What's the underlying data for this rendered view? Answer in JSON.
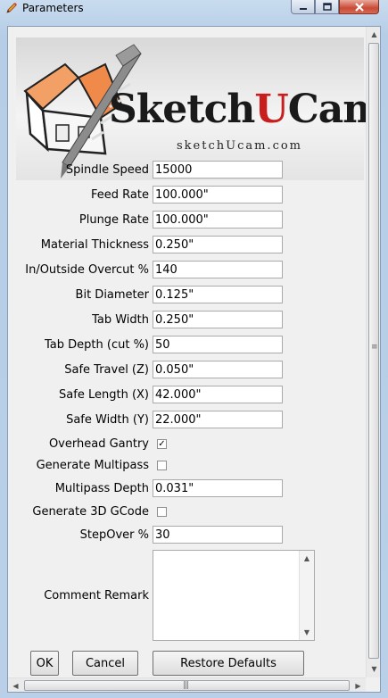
{
  "window": {
    "title": "Parameters",
    "controls": {
      "minimize_icon": "minimize-icon",
      "maximize_icon": "maximize-icon",
      "close_icon": "close-icon"
    }
  },
  "logo": {
    "wordmark_prefix": "Sketch",
    "wordmark_accent": "U",
    "wordmark_suffix": "Cam",
    "registered": "®",
    "url": "sketchUcam.com",
    "accent_color": "#c81e1e"
  },
  "fields": [
    {
      "label": "Spindle Speed",
      "value": "15000"
    },
    {
      "label": "Feed Rate",
      "value": "100.000\""
    },
    {
      "label": "Plunge Rate",
      "value": "100.000\""
    },
    {
      "label": "Material Thickness",
      "value": "0.250\""
    },
    {
      "label": "In/Outside Overcut %",
      "value": "140"
    },
    {
      "label": "Bit Diameter",
      "value": "0.125\""
    },
    {
      "label": "Tab Width",
      "value": "0.250\""
    },
    {
      "label": "Tab Depth (cut %)",
      "value": "50"
    },
    {
      "label": "Safe Travel (Z)",
      "value": "0.050\""
    },
    {
      "label": "Safe Length (X)",
      "value": "42.000\""
    },
    {
      "label": "Safe Width (Y)",
      "value": "22.000\""
    }
  ],
  "overhead_gantry": {
    "label": "Overhead Gantry",
    "checked": true,
    "mark": "✓"
  },
  "generate_multipass": {
    "label": "Generate Multipass",
    "checked": false
  },
  "multipass_depth": {
    "label": "Multipass Depth",
    "value": "0.031\""
  },
  "generate_3d_gcode": {
    "label": "Generate 3D GCode",
    "checked": false
  },
  "stepover": {
    "label": "StepOver %",
    "value": "30"
  },
  "comment": {
    "label": "Comment Remark",
    "value": ""
  },
  "buttons": {
    "ok": "OK",
    "cancel": "Cancel",
    "restore": "Restore Defaults"
  }
}
